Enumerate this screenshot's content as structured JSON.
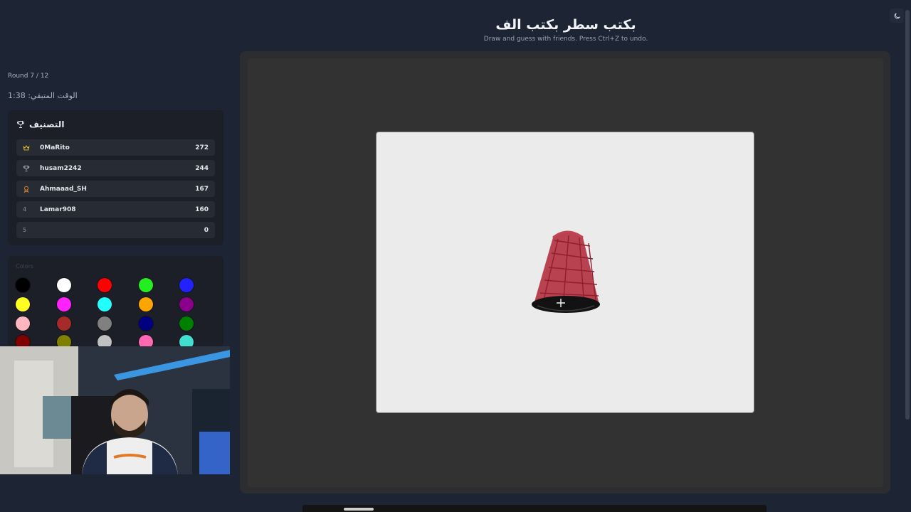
{
  "header": {
    "title": "بكتب سطر بكتب الف",
    "subtitle": "Draw and guess with friends. Press Ctrl+Z to undo.",
    "theme_icon": "moon-icon"
  },
  "game": {
    "round": "Round 7 / 12",
    "timer": "الوقت المتبقي: 1:38"
  },
  "ranking": {
    "title": "التصنيف",
    "icon": "trophy-icon",
    "players": [
      {
        "rank": "",
        "name": "0MaRito",
        "score": "272",
        "icon": "crown-icon"
      },
      {
        "rank": "",
        "name": "husam2242",
        "score": "244",
        "icon": "trophy-icon"
      },
      {
        "rank": "",
        "name": "Ahmaaad_SH",
        "score": "167",
        "icon": "medal-icon"
      },
      {
        "rank": "4",
        "name": "Lamar908",
        "score": "160",
        "icon": ""
      },
      {
        "rank": "5",
        "name": "",
        "score": "0",
        "icon": ""
      }
    ]
  },
  "palette": {
    "label": "Colors",
    "colors": [
      "#000000",
      "#ffffff",
      "#ff0000",
      "#22ee22",
      "#2222ff",
      "#ffff22",
      "#ff22ff",
      "#22ffff",
      "#ffa500",
      "#8b008b",
      "#ffb6c1",
      "#a52a2a",
      "#808080",
      "#000080",
      "#008000",
      "#800000",
      "#808000",
      "#c0c0c0",
      "#ff69b4",
      "#40e0d0"
    ]
  },
  "colors": {
    "background": "#1d2433",
    "panel": "#1c1f27",
    "canvas_paper": "#ebebeb",
    "crown": "#f2c230",
    "medal": "#e08a2b"
  }
}
